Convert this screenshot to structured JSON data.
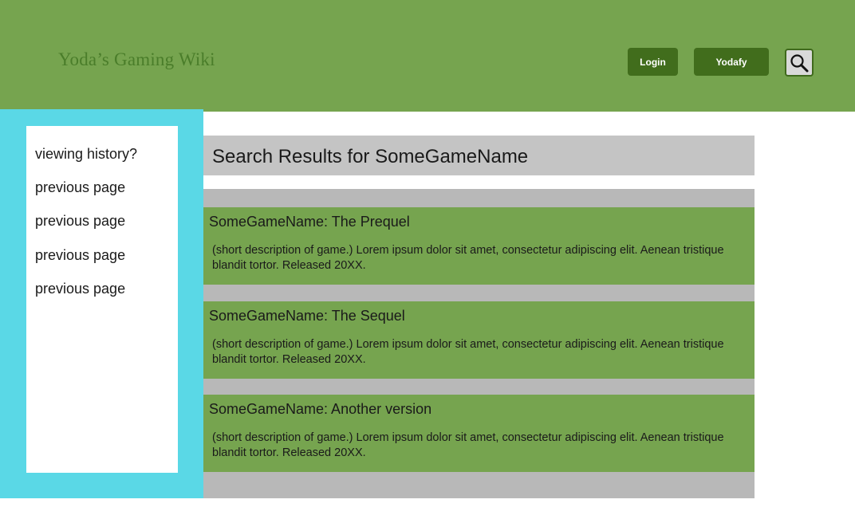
{
  "header": {
    "site_title": "Yoda’s Gaming Wiki",
    "login_label": "Login",
    "yodafy_label": "Yodafy",
    "search_icon": "magnifying-glass"
  },
  "sidebar": {
    "items": [
      {
        "label": "viewing history?"
      },
      {
        "label": "previous page"
      },
      {
        "label": "previous page"
      },
      {
        "label": "previous page"
      },
      {
        "label": "previous page"
      }
    ]
  },
  "main": {
    "results_title": "Search Results for SomeGameName",
    "results": [
      {
        "title": "SomeGameName: The Prequel",
        "description": "(short description of game.) Lorem ipsum dolor sit amet, consectetur adipiscing elit. Aenean tristique blandit tortor. Released 20XX."
      },
      {
        "title": "SomeGameName: The Sequel",
        "description": "(short description of game.) Lorem ipsum dolor sit amet, consectetur adipiscing elit. Aenean tristique blandit tortor. Released 20XX."
      },
      {
        "title": "SomeGameName: Another version",
        "description": "(short description of game.) Lorem ipsum dolor sit amet, consectetur adipiscing elit. Aenean tristique blandit tortor. Released 20XX."
      }
    ]
  },
  "colors": {
    "header_bg": "#76a44f",
    "button_bg": "#416d1c",
    "sidebar_bg": "#5ad8e6",
    "card_bg": "#76a44f",
    "list_bg": "#b8b8b8",
    "results_header_bg": "#c4c4c4"
  }
}
